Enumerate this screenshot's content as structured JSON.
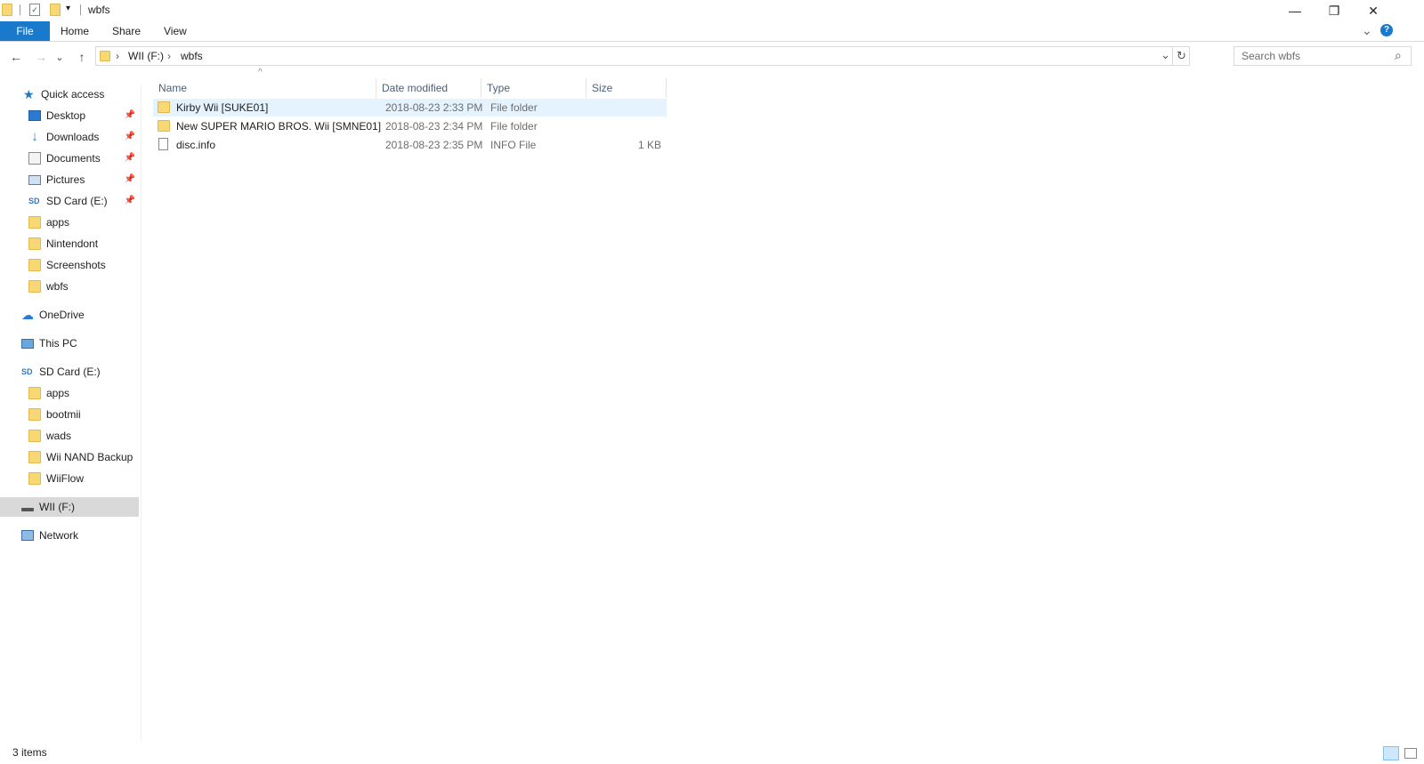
{
  "window": {
    "title": "wbfs",
    "minimize_glyph": "—",
    "maximize_glyph": "❐",
    "close_glyph": "✕"
  },
  "ribbon": {
    "tabs": [
      "File",
      "Home",
      "Share",
      "View"
    ],
    "help_glyph": "?",
    "expand_glyph": "⌄"
  },
  "address": {
    "back_glyph": "←",
    "forward_glyph": "→",
    "recent_glyph": "⌄",
    "up_glyph": "↑",
    "crumbs": [
      "WII (F:)",
      "wbfs"
    ],
    "crumb_sep": "›",
    "dropdown_glyph": "⌄",
    "refresh_glyph": "↻",
    "search_placeholder": "Search wbfs",
    "search_glyph": "⌕"
  },
  "nav": {
    "quick_access": "Quick access",
    "quick_items": [
      {
        "label": "Desktop",
        "icon": "desktop-icon",
        "pinned": true
      },
      {
        "label": "Downloads",
        "icon": "downloads-icon",
        "pinned": true
      },
      {
        "label": "Documents",
        "icon": "documents-icon",
        "pinned": true
      },
      {
        "label": "Pictures",
        "icon": "pictures-icon",
        "pinned": true
      },
      {
        "label": "SD Card (E:)",
        "icon": "sd-card-icon",
        "pinned": true
      },
      {
        "label": "apps",
        "icon": "folder-icon",
        "pinned": false
      },
      {
        "label": "Nintendont",
        "icon": "folder-icon",
        "pinned": false
      },
      {
        "label": "Screenshots",
        "icon": "folder-icon",
        "pinned": false
      },
      {
        "label": "wbfs",
        "icon": "folder-icon",
        "pinned": false
      }
    ],
    "onedrive": "OneDrive",
    "this_pc": "This PC",
    "sd_card": "SD Card (E:)",
    "sd_items": [
      "apps",
      "bootmii",
      "wads",
      "Wii NAND Backup",
      "WiiFlow"
    ],
    "wii_drive": "WII (F:)",
    "network": "Network",
    "pin_glyph": "📌"
  },
  "columns": [
    "Name",
    "Date modified",
    "Type",
    "Size"
  ],
  "sort_glyph": "^",
  "files": [
    {
      "name": "Kirby Wii [SUKE01]",
      "date": "2018-08-23 2:33 PM",
      "type": "File folder",
      "size": "",
      "icon": "folder-icon",
      "selected": true
    },
    {
      "name": "New SUPER MARIO BROS. Wii [SMNE01]",
      "date": "2018-08-23 2:34 PM",
      "type": "File folder",
      "size": "",
      "icon": "folder-icon",
      "selected": false
    },
    {
      "name": "disc.info",
      "date": "2018-08-23 2:35 PM",
      "type": "INFO File",
      "size": "1 KB",
      "icon": "file-icon",
      "selected": false
    }
  ],
  "status": {
    "count": "3 items"
  },
  "colors": {
    "accent": "#1979ca",
    "selected_row": "#e5f3ff",
    "selected_nav": "#d9d9d9",
    "folder": "#f8d775"
  }
}
